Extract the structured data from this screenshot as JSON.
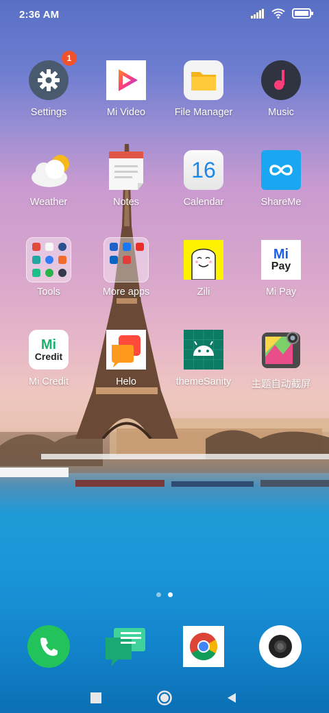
{
  "status": {
    "time": "2:36 AM",
    "icons": [
      "signal-icon",
      "wifi-icon",
      "battery-icon"
    ]
  },
  "apps": {
    "settings": {
      "label": "Settings",
      "badge": "1"
    },
    "mi_video": {
      "label": "Mi Video"
    },
    "file_manager": {
      "label": "File Manager"
    },
    "music": {
      "label": "Music"
    },
    "weather": {
      "label": "Weather"
    },
    "notes": {
      "label": "Notes"
    },
    "calendar": {
      "label": "Calendar",
      "date": "16"
    },
    "shareme": {
      "label": "ShareMe"
    },
    "tools": {
      "label": "Tools"
    },
    "more_apps": {
      "label": "More apps"
    },
    "zili": {
      "label": "Zili"
    },
    "mi_pay": {
      "label": "Mi Pay",
      "icon_text_top": "Mi",
      "icon_text_bottom": "Pay"
    },
    "mi_credit": {
      "label": "Mi Credit",
      "icon_text_top": "Mi",
      "icon_text_bottom": "Credit"
    },
    "helo": {
      "label": "Helo"
    },
    "theme_sanity": {
      "label": "themeSanity"
    },
    "auto_screenshot": {
      "label": "主题自动截屏"
    }
  },
  "dock": [
    "phone",
    "messaging",
    "chrome",
    "camera"
  ],
  "pages": {
    "count": 2,
    "active": 2
  },
  "navbar": [
    "recents-button",
    "home-button",
    "back-button"
  ]
}
